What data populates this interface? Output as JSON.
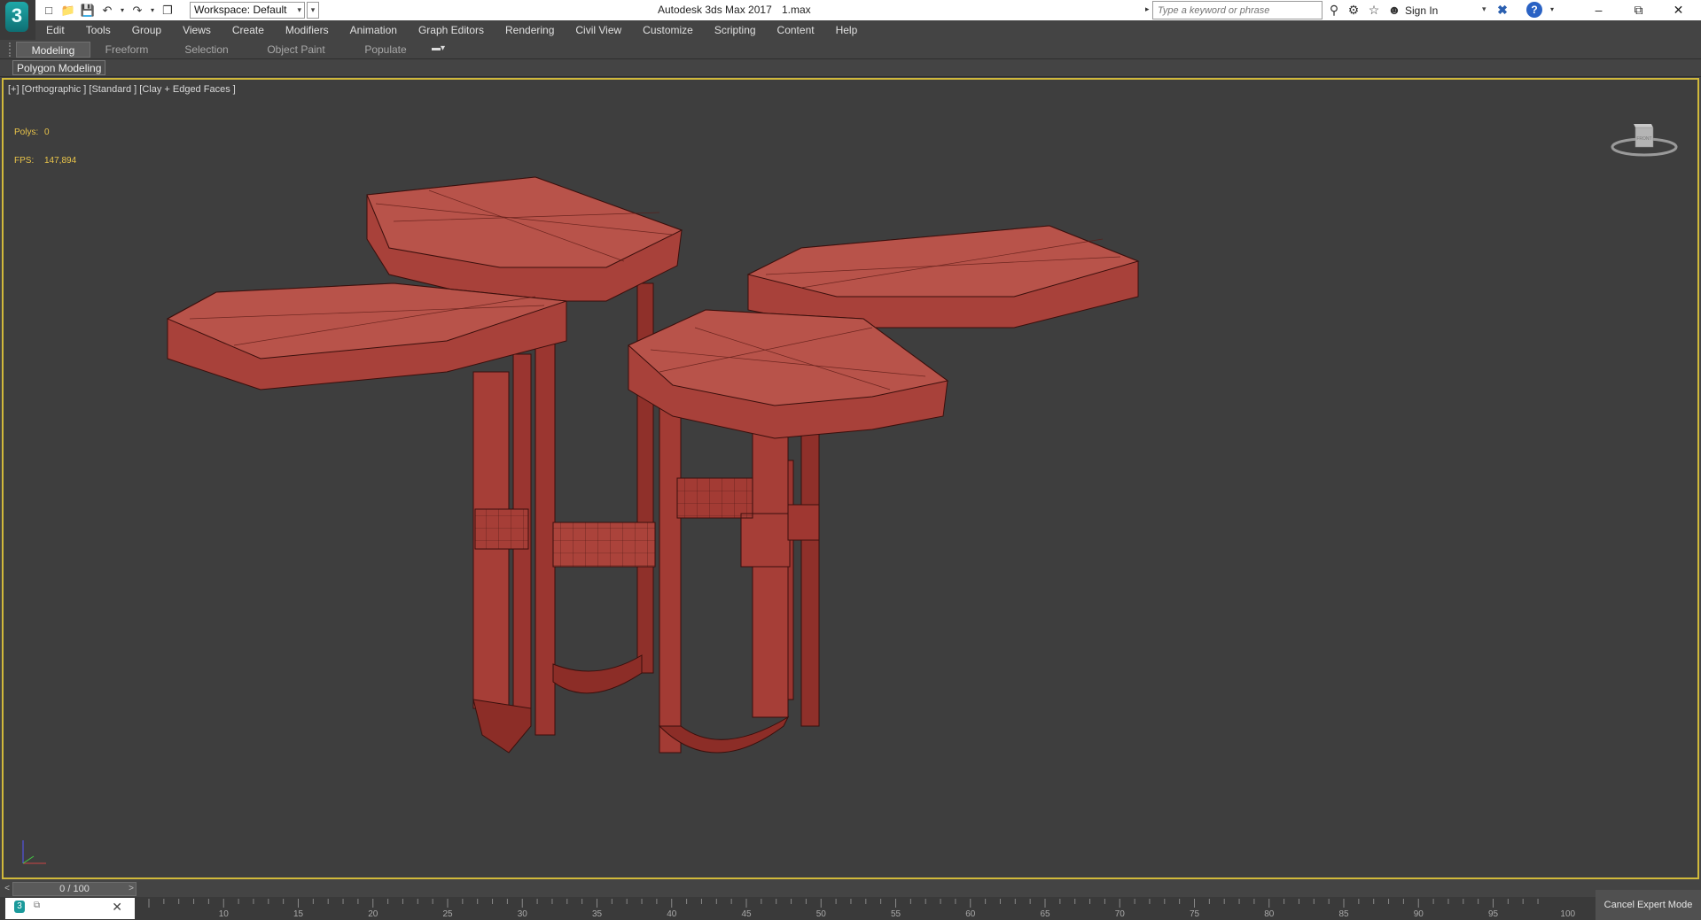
{
  "titlebar": {
    "app_title": "Autodesk 3ds Max 2017",
    "file_name": "1.max",
    "workspace_label": "Workspace: Default",
    "search_placeholder": "Type a keyword or phrase",
    "sign_in": "Sign In"
  },
  "menu": [
    "Edit",
    "Tools",
    "Group",
    "Views",
    "Create",
    "Modifiers",
    "Animation",
    "Graph Editors",
    "Rendering",
    "Civil View",
    "Customize",
    "Scripting",
    "Content",
    "Help"
  ],
  "ribbon": {
    "tabs": [
      "Modeling",
      "Freeform",
      "Selection",
      "Object Paint",
      "Populate"
    ],
    "active_tab": "Modeling",
    "panel_label": "Polygon Modeling"
  },
  "viewport": {
    "label": "[+] [Orthographic ] [Standard ] [Clay + Edged Faces ]",
    "polys_label": "Polys:",
    "polys_value": "0",
    "fps_label": "FPS:",
    "fps_value": "147,894",
    "viewcube_face": "FRONT"
  },
  "timeline": {
    "frame_display": "0 / 100",
    "ticks": [
      "10",
      "15",
      "20",
      "25",
      "30",
      "35",
      "40",
      "45",
      "50",
      "55",
      "60",
      "65",
      "70",
      "75",
      "80",
      "85",
      "90",
      "95",
      "100"
    ]
  },
  "status": {
    "cancel_expert": "Cancel Expert Mode"
  },
  "colors": {
    "viewport_border": "#d1b93b",
    "model_red": "#a8413a",
    "stat_yellow": "#e9c44a"
  }
}
